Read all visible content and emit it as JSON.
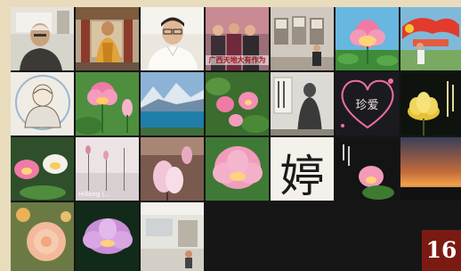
{
  "gallery": {
    "tiles": [
      {
        "name": "participant-elder-man-video"
      },
      {
        "name": "participant-monk-temple-video"
      },
      {
        "name": "participant-man-white-shirt-video"
      },
      {
        "name": "participant-banner-group-photo",
        "banner": "广西天地大有作为"
      },
      {
        "name": "participant-exhibition-hall-photo"
      },
      {
        "name": "participant-pink-lotus-photo"
      },
      {
        "name": "participant-red-ribbon-photo"
      },
      {
        "name": "participant-buddha-drawing"
      },
      {
        "name": "participant-pink-lotus-bud-photo"
      },
      {
        "name": "participant-mountain-lake-photo"
      },
      {
        "name": "participant-lotus-pond-photo"
      },
      {
        "name": "participant-statue-calligraphy-photo"
      },
      {
        "name": "participant-heart-greeting",
        "heart_text": "珍爱"
      },
      {
        "name": "participant-yellow-lotus-photo"
      },
      {
        "name": "participant-lotus-pair-photo"
      },
      {
        "name": "participant-lotus-buds-named",
        "label": "Hillong (…"
      },
      {
        "name": "participant-magnolia-photo"
      },
      {
        "name": "participant-pink-lotus-large-photo"
      },
      {
        "name": "participant-calligraphy-character",
        "glyph": "婷"
      },
      {
        "name": "participant-lotus-dark-photo"
      },
      {
        "name": "participant-sunset-photo"
      },
      {
        "name": "participant-peach-rose-photo"
      },
      {
        "name": "participant-purple-lotus-photo"
      },
      {
        "name": "participant-office-room-video"
      }
    ]
  },
  "participant_count": "16"
}
